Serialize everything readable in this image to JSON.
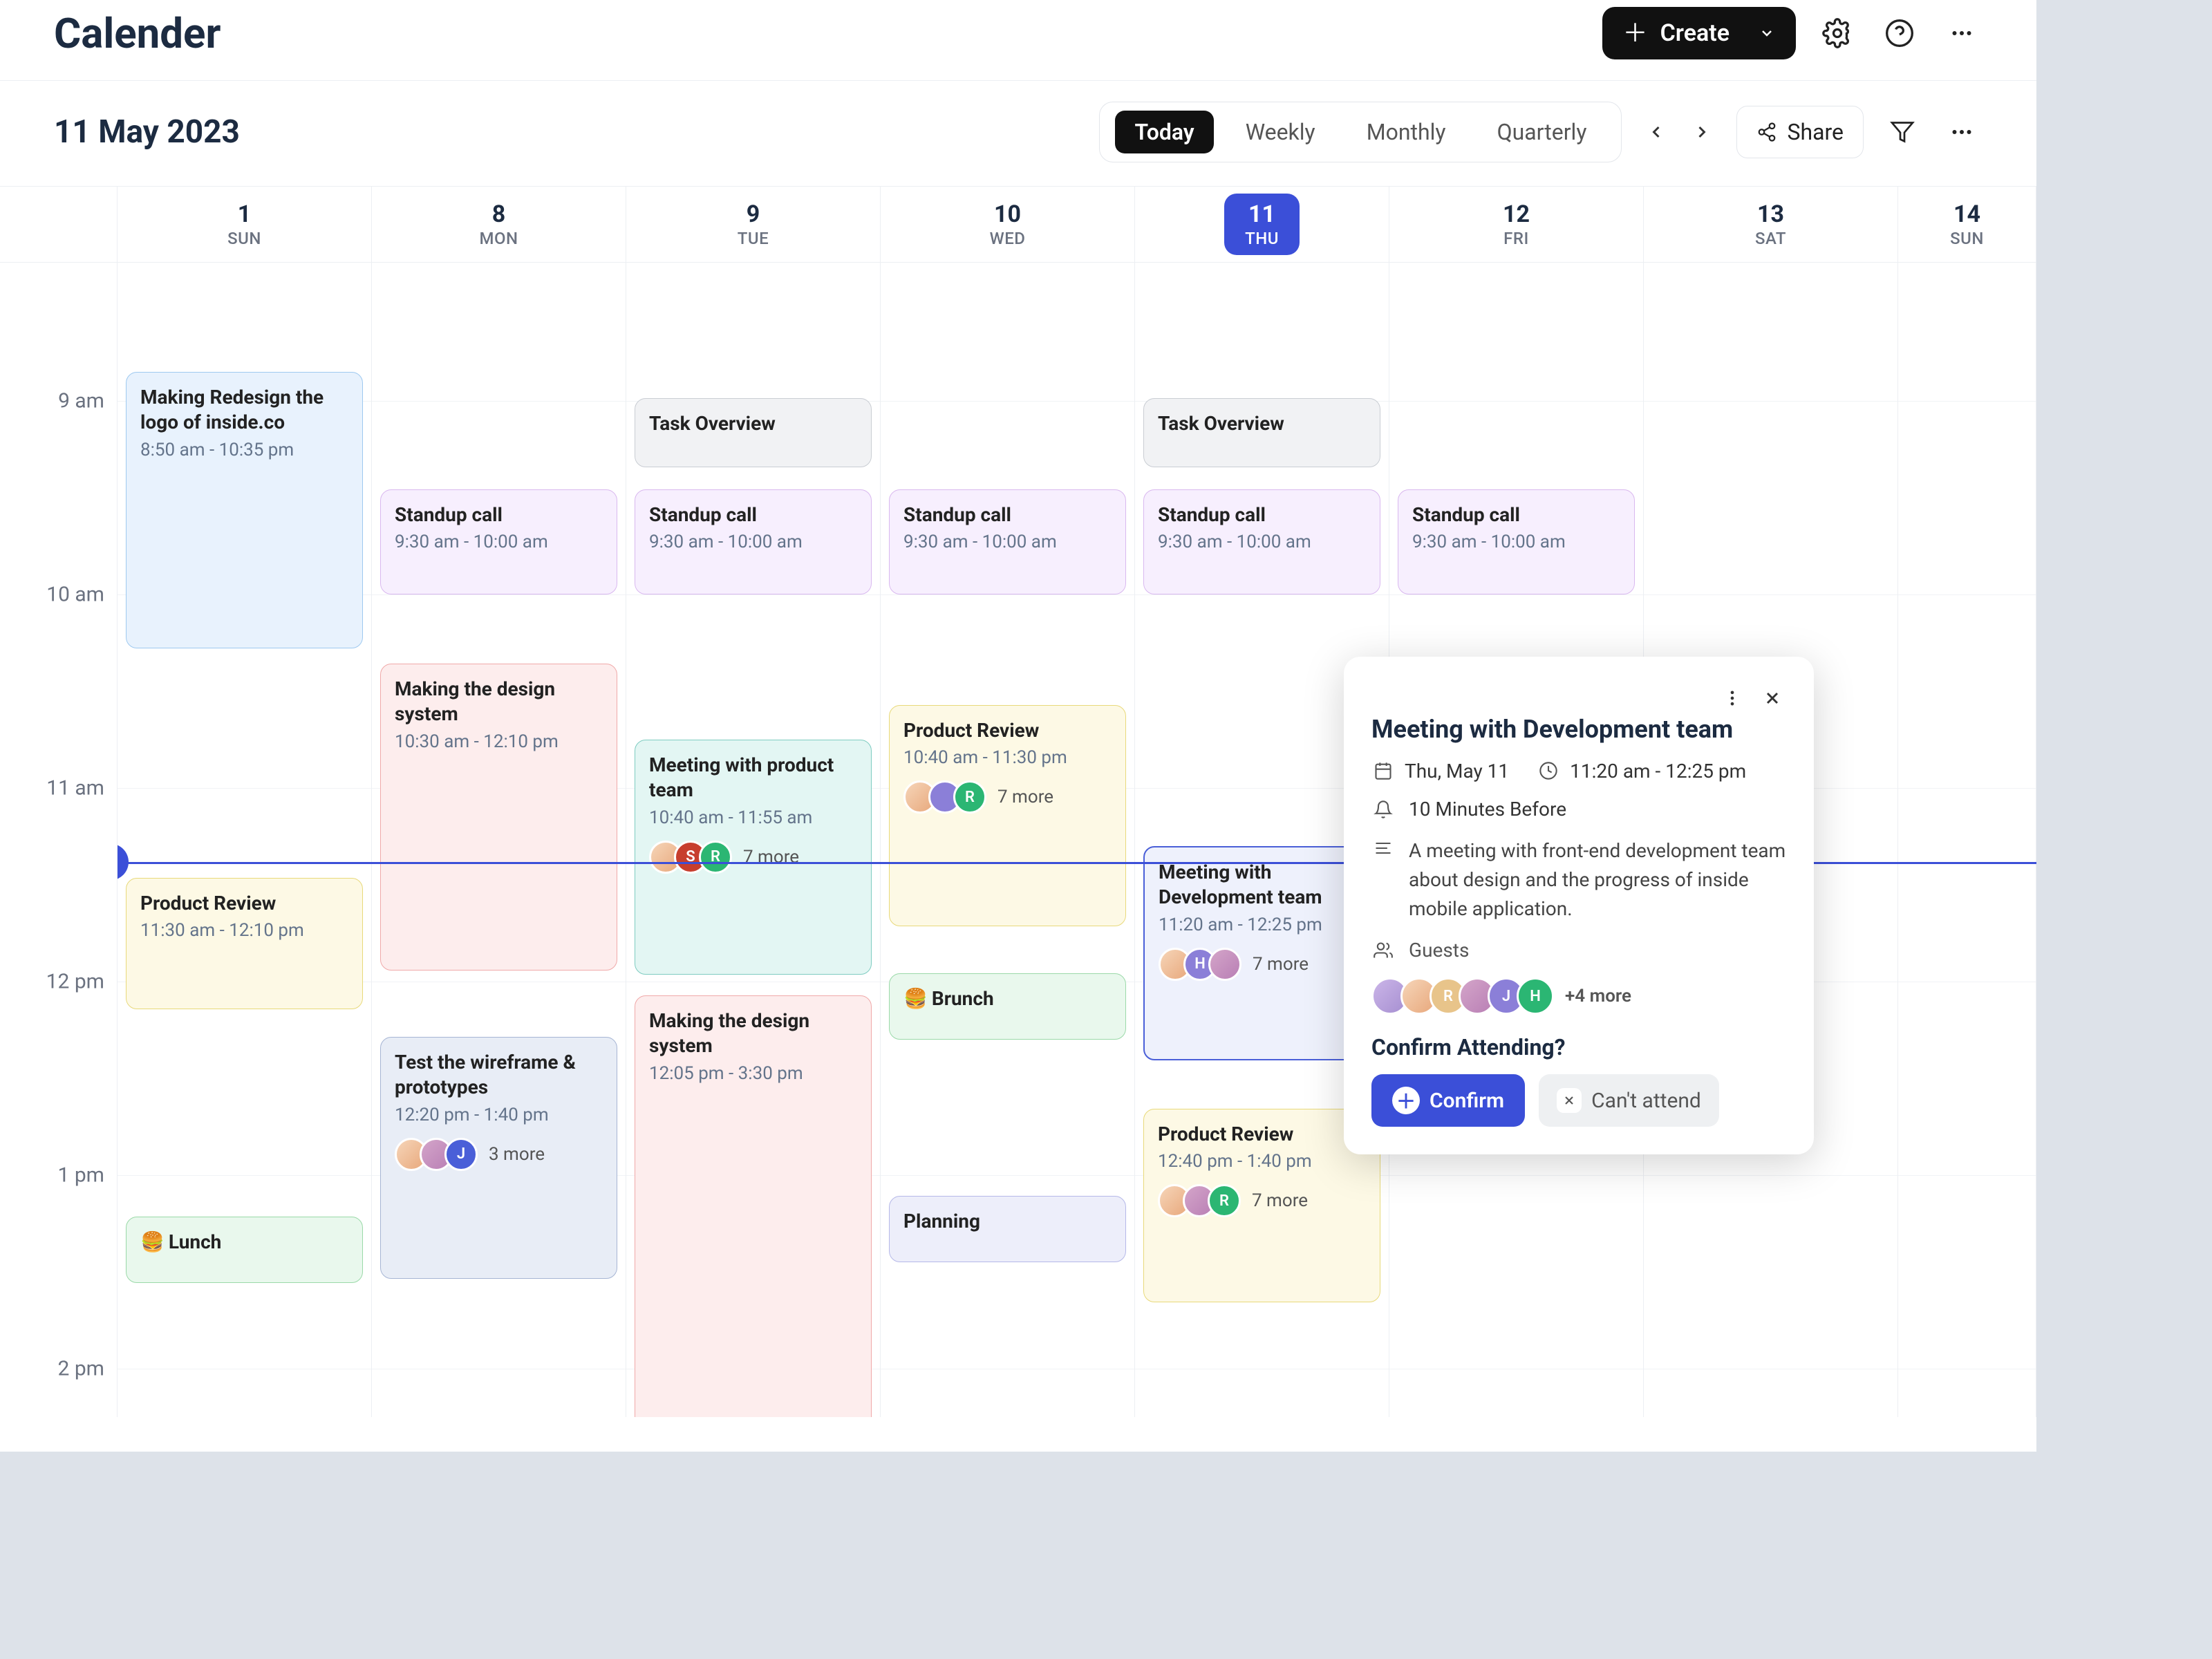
{
  "header": {
    "title": "Calender",
    "create": "Create",
    "share": "Share"
  },
  "date_bar": {
    "title": "11 May 2023",
    "views": {
      "today": "Today",
      "weekly": "Weekly",
      "monthly": "Monthly",
      "quarterly": "Quarterly"
    }
  },
  "time_labels": [
    "9 am",
    "10 am",
    "11 am",
    "12 pm",
    "1 pm",
    "2 pm"
  ],
  "now": "11:23",
  "days": [
    {
      "num": "1",
      "name": "SUN"
    },
    {
      "num": "8",
      "name": "MON"
    },
    {
      "num": "9",
      "name": "TUE"
    },
    {
      "num": "10",
      "name": "WED"
    },
    {
      "num": "11",
      "name": "THU",
      "today": true
    },
    {
      "num": "12",
      "name": "FRI"
    },
    {
      "num": "13",
      "name": "SAT"
    },
    {
      "num": "14",
      "name": "SUN"
    }
  ],
  "events": {
    "sun_redesign": {
      "title": "Making Redesign the logo of inside.co",
      "time": "8:50 am - 10:35 pm"
    },
    "sun_review": {
      "title": "Product Review",
      "time": "11:30 am - 12:10 pm"
    },
    "sun_lunch": {
      "title": "Lunch"
    },
    "mon_standup": {
      "title": "Standup call",
      "time": "9:30 am - 10:00 am"
    },
    "mon_design": {
      "title": "Making the design system",
      "time": "10:30 am - 12:10 pm"
    },
    "mon_wireframe": {
      "title": "Test the wireframe & prototypes",
      "time": "12:20 pm - 1:40 pm",
      "more": "3 more"
    },
    "tue_task": {
      "title": "Task Overview"
    },
    "tue_standup": {
      "title": "Standup call",
      "time": "9:30 am - 10:00 am"
    },
    "tue_product": {
      "title": "Meeting with product team",
      "time": "10:40 am - 11:55 am",
      "more": "7 more"
    },
    "tue_design": {
      "title": "Making the design system",
      "time": "12:05 pm - 3:30 pm"
    },
    "wed_standup": {
      "title": "Standup call",
      "time": "9:30 am - 10:00 am"
    },
    "wed_review": {
      "title": "Product Review",
      "time": "10:40 am - 11:30 pm",
      "more": "7 more"
    },
    "wed_brunch": {
      "title": "Brunch"
    },
    "wed_planning": {
      "title": "Planning"
    },
    "thu_task": {
      "title": "Task Overview"
    },
    "thu_standup": {
      "title": "Standup call",
      "time": "9:30 am - 10:00 am"
    },
    "thu_dev": {
      "title": "Meeting with Development team",
      "time": "11:20 am - 12:25 pm",
      "more": "7 more"
    },
    "thu_review": {
      "title": "Product Review",
      "time": "12:40 pm - 1:40 pm",
      "more": "7 more"
    },
    "fri_standup": {
      "title": "Standup call",
      "time": "9:30 am - 10:00 am"
    }
  },
  "popover": {
    "title": "Meeting with Development team",
    "date": "Thu, May 11",
    "time": "11:20 am - 12:25 pm",
    "reminder": "10 Minutes Before",
    "desc": "A meeting with front-end development team about design and the progress of inside mobile application.",
    "guests_label": "Guests",
    "guests_more": "+4 more",
    "confirm_head": "Confirm Attending?",
    "confirm": "Confirm",
    "decline": "Can't attend"
  }
}
